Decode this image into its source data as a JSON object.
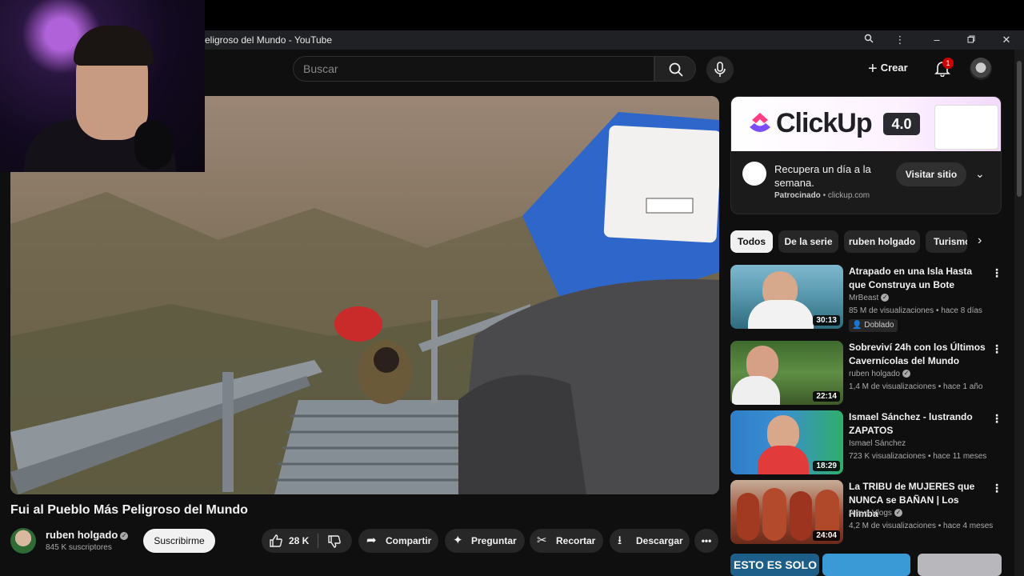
{
  "window": {
    "title": "eligroso del Mundo - YouTube"
  },
  "search": {
    "placeholder": "Buscar"
  },
  "header": {
    "create_label": "Crear",
    "notif_count": "1"
  },
  "video": {
    "title": "Fui al Pueblo Más Peligroso del Mundo",
    "channel": "ruben holgado",
    "subscribers": "845 K suscriptores",
    "subscribe_label": "Suscribirme",
    "likes": "28 K",
    "share_label": "Compartir",
    "ask_label": "Preguntar",
    "clip_label": "Recortar",
    "download_label": "Descargar"
  },
  "ad": {
    "brand": "ClickUp",
    "version": "4.0",
    "headline": "Recupera un día a la semana.",
    "sponsored": "Patrocinado",
    "domain": "clickup.com",
    "visit_label": "Visitar sitio"
  },
  "chips": [
    "Todos",
    "De la serie",
    "ruben holgado",
    "Turismo"
  ],
  "recommendations": [
    {
      "title": "Atrapado en una Isla Hasta que Construya un Bote",
      "channel": "MrBeast",
      "meta": "85 M de visualizaciones • hace 8 días",
      "duration": "30:13",
      "badge": "Doblado",
      "thumb_color": "#5a9ab0"
    },
    {
      "title": "Sobreviví 24h con los Últimos Cavernícolas del Mundo",
      "channel": "ruben holgado",
      "meta": "1,4 M de visualizaciones • hace 1 año",
      "duration": "22:14",
      "thumb_color": "#4d7a3a"
    },
    {
      "title": "Ismael Sánchez - lustrando ZAPATOS",
      "channel": "Ismael Sánchez",
      "meta": "723 K visualizaciones • hace 11 meses",
      "duration": "18:29",
      "thumb_color": "#3b8fd0"
    },
    {
      "title": "La TRIBU de MUJERES que NUNCA se BAÑAN | Los Himba",
      "channel": "Araya Vlogs",
      "meta": "4,2 M de visualizaciones • hace 4 meses",
      "duration": "24:04",
      "thumb_color": "#9a4a32"
    }
  ],
  "bottom_peek": {
    "text": "ESTO ES SOLO"
  },
  "colors": {
    "background": "#0f0f0f",
    "surface": "#272727",
    "accent": "#cc0000"
  }
}
